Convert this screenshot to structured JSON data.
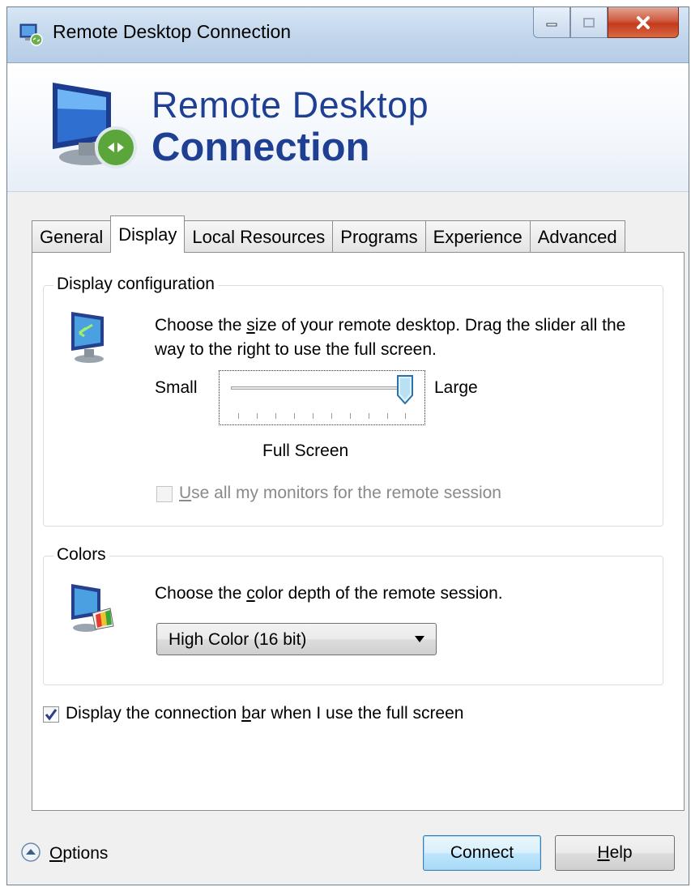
{
  "window": {
    "title": "Remote Desktop Connection"
  },
  "header": {
    "line1": "Remote Desktop",
    "line2": "Connection"
  },
  "tabs": [
    {
      "label": "General"
    },
    {
      "label": "Display"
    },
    {
      "label": "Local Resources"
    },
    {
      "label": "Programs"
    },
    {
      "label": "Experience"
    },
    {
      "label": "Advanced"
    }
  ],
  "display_config": {
    "group_title": "Display configuration",
    "description_parts": [
      "Choose the ",
      "s",
      "ize of your remote desktop. Drag the slider all the way to the right to use the full screen."
    ],
    "slider_min_label": "Small",
    "slider_max_label": "Large",
    "slider_value_label": "Full Screen",
    "slider_position": 1.0,
    "monitors_checkbox_parts": [
      "U",
      "se all my monitors for the remote session"
    ],
    "monitors_checked": false
  },
  "colors": {
    "group_title": "Colors",
    "description_parts": [
      "Choose the ",
      "c",
      "olor depth of the remote session."
    ],
    "selected_depth": "High Color (16 bit)"
  },
  "connection_bar": {
    "label_parts": [
      "Display the connection ",
      "b",
      "ar when I use the full screen"
    ],
    "checked": true
  },
  "footer": {
    "options_parts": [
      "O",
      "ptions"
    ],
    "connect_label": "Connect",
    "help_parts": [
      "H",
      "elp"
    ]
  },
  "colors_theme": {
    "header_text": "#1f3f93",
    "default_button_border": "#3c7fb1",
    "close_button": "#c43a1d"
  }
}
